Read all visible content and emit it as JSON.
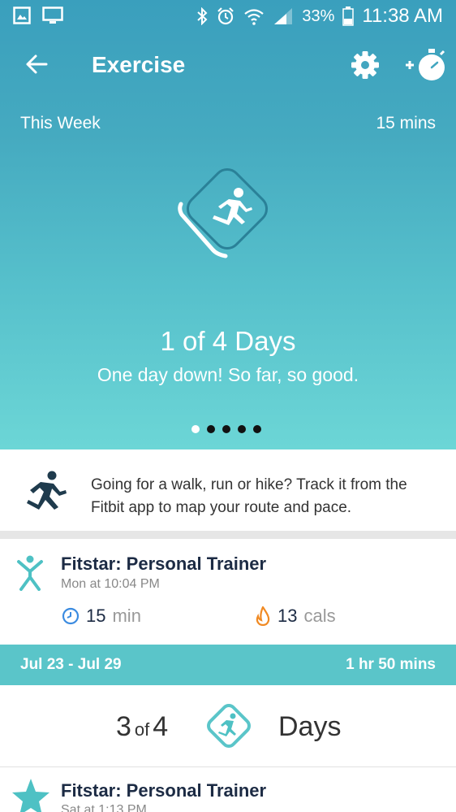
{
  "status_bar": {
    "battery": "33%",
    "time": "11:38 AM"
  },
  "header": {
    "title": "Exercise"
  },
  "weekly_goal": {
    "label": "This Week",
    "total": "15 mins",
    "progress": "1 of 4 Days",
    "progress_fraction": 0.25,
    "message": "One day down! So far, so good.",
    "page_count": 5,
    "active_page": 1
  },
  "tip": {
    "text": "Going for a walk, run or hike? Track it from the Fitbit app to map your route and pace."
  },
  "activities": [
    {
      "name": "Fitstar: Personal Trainer",
      "time": "Mon at 10:04 PM",
      "duration_value": "15",
      "duration_unit": "min",
      "calories_value": "13",
      "calories_unit": "cals"
    }
  ],
  "previous_week": {
    "range": "Jul 23 - Jul 29",
    "total": "1 hr 50 mins",
    "count": "3",
    "of": "of",
    "goal": "4",
    "label": "Days",
    "progress_fraction": 0.75
  },
  "previous_activities": [
    {
      "name": "Fitstar: Personal Trainer",
      "time": "Sat at 1:13 PM"
    }
  ],
  "colors": {
    "header_top": "#3a9fbd",
    "header_bottom": "#6cd6d6",
    "teal_accent": "#5ac5c9",
    "activity_icon": "#4ec1c4",
    "clock_blue": "#3b8be0",
    "flame_orange": "#f08a24",
    "dark_text": "#1c2b44"
  }
}
